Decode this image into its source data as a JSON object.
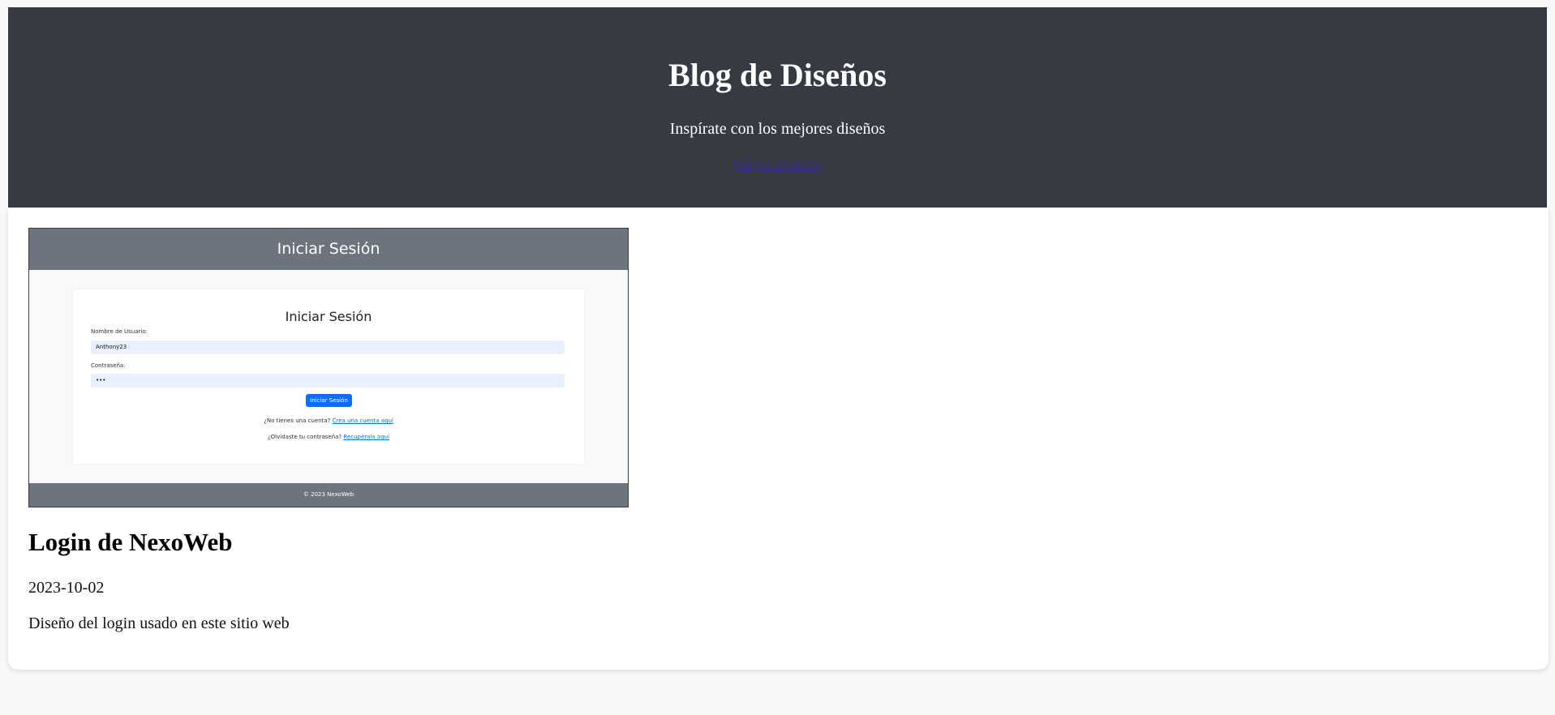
{
  "header": {
    "title": "Blog de Diseños",
    "tagline": "Inspírate con los mejores diseños",
    "back_link": "Volver al inicio"
  },
  "post": {
    "image": {
      "header_title": "Iniciar Sesión",
      "form_title": "Iniciar Sesión",
      "username_label": "Nombre de Usuario:",
      "username_value": "Anthony23",
      "password_label": "Contraseña:",
      "password_value": "•••",
      "submit_label": "Iniciar Sesión",
      "signup_text": "¿No tienes una cuenta?",
      "signup_link": "Crea una cuenta aquí",
      "forgot_text": "¿Olvidaste tu contraseña?",
      "forgot_link": "Recupérala aquí",
      "footer_text": "© 2023 NexoWeb"
    },
    "title": "Login de NexoWeb",
    "date": "2023-10-02",
    "description": "Diseño del login usado en este sitio web"
  },
  "colors": {
    "header_bg": "#353a43",
    "page_bg": "#f7f8f9",
    "card_bg": "#ffffff",
    "thumb_header_bg": "#6c757d",
    "thumb_button": "#0d6efd",
    "link": "#3a2a8a"
  }
}
